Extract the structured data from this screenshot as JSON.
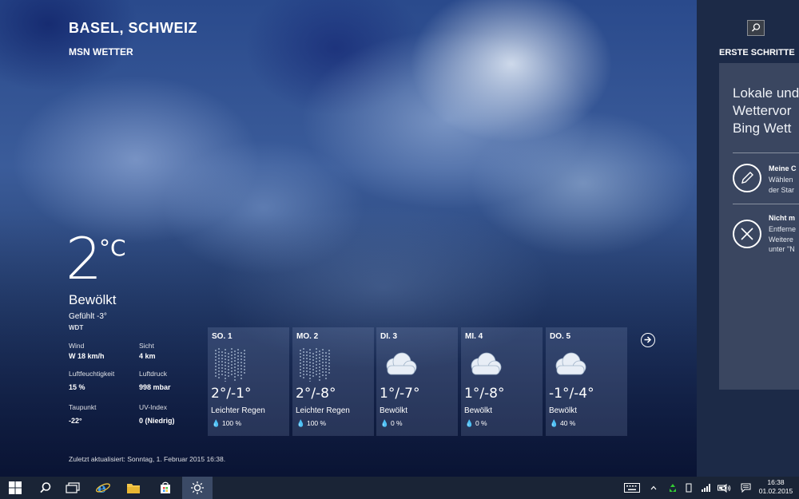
{
  "header": {
    "city": "BASEL, SCHWEIZ",
    "app_name": "MSN WETTER"
  },
  "current": {
    "temperature": "2",
    "unit": "°C",
    "condition": "Bewölkt",
    "feels_like": "Gefühlt -3°",
    "provider": "WDT"
  },
  "details": {
    "wind_label": "Wind",
    "wind_value": "W 18 km/h",
    "visibility_label": "Sicht",
    "visibility_value": "4 km",
    "humidity_label": "Luftfeuchtigkeit",
    "humidity_value": "15 %",
    "pressure_label": "Luftdruck",
    "pressure_value": "998 mbar",
    "dewpoint_label": "Taupunkt",
    "dewpoint_value": "-22°",
    "uv_label": "UV-Index",
    "uv_value": "0 (Niedrig)"
  },
  "forecast": [
    {
      "day": "SO. 1",
      "temps": "2°/-1°",
      "condition": "Leichter Regen",
      "precip": "100 %",
      "icon": "rain-icon"
    },
    {
      "day": "MO. 2",
      "temps": "2°/-8°",
      "condition": "Leichter Regen",
      "precip": "100 %",
      "icon": "rain-icon"
    },
    {
      "day": "DI. 3",
      "temps": "1°/-7°",
      "condition": "Bewölkt",
      "precip": "0 %",
      "icon": "cloud-icon"
    },
    {
      "day": "MI. 4",
      "temps": "1°/-8°",
      "condition": "Bewölkt",
      "precip": "0 %",
      "icon": "cloud-icon"
    },
    {
      "day": "DO. 5",
      "temps": "-1°/-4°",
      "condition": "Bewölkt",
      "precip": "40 %",
      "icon": "cloud-icon"
    }
  ],
  "updated": "Zuletzt aktualisiert: Sonntag, 1. Februar 2015 16:38.",
  "side_panel": {
    "title": "ERSTE SCHRITTE",
    "heading": "Lokale und\nWettervor\nBing Wett",
    "item1_title": "Meine C",
    "item1_desc": "Wählen\nder Star",
    "item2_title": "Nicht m",
    "item2_desc": "Entferne\nWeitere\nunter \"N"
  },
  "taskbar": {
    "time": "16:38",
    "date": "01.02.2015"
  }
}
